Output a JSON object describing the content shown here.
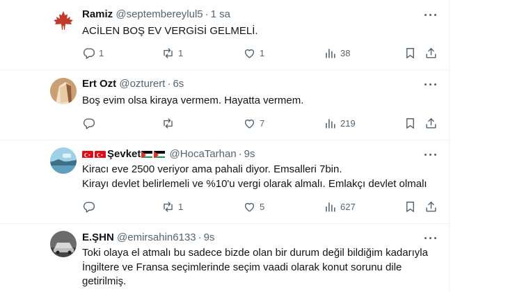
{
  "tweets": [
    {
      "display_name": "Ramiz",
      "handle": "@septembereylul5",
      "time": "1 sa",
      "lines": [
        "ACİLEN BOŞ EV VERGİSİ GELMELİ."
      ],
      "replies": "1",
      "reposts": "1",
      "likes": "1",
      "views": "38"
    },
    {
      "display_name": "Ert Ozt",
      "handle": "@ozturert",
      "time": "6s",
      "lines": [
        "Boş evim olsa kiraya vermem. Hayatta vermem."
      ],
      "replies": "",
      "reposts": "",
      "likes": "7",
      "views": "219"
    },
    {
      "display_name": "Şevket",
      "handle": "@HocaTarhan",
      "time": "9s",
      "lines": [
        "Kiracı eve 2500 veriyor ama pahali diyor. Emsalleri 7bin.",
        "Kirayı devlet belirlemeli ve %10'u vergi olarak almalı. Emlakçı devlet olmalı"
      ],
      "replies": "",
      "reposts": "1",
      "likes": "5",
      "views": "627"
    },
    {
      "display_name": "E.ŞHN",
      "handle": "@emirsahin6133",
      "time": "9s",
      "lines": [
        "Toki olaya el atmalı bu sadece bizde olan bir durum değil bildiğim kadarıyla",
        "İngiltere ve Fransa seçimlerinde seçim vaadi olarak konut sorunu dile",
        "getirilmiş."
      ]
    }
  ],
  "colors": {
    "text": "#0f1419",
    "secondary": "#536471",
    "divider": "#eff3f4"
  },
  "icons": [
    "reply-icon",
    "repost-icon",
    "like-icon",
    "views-icon",
    "bookmark-icon",
    "share-icon",
    "more-icon"
  ]
}
